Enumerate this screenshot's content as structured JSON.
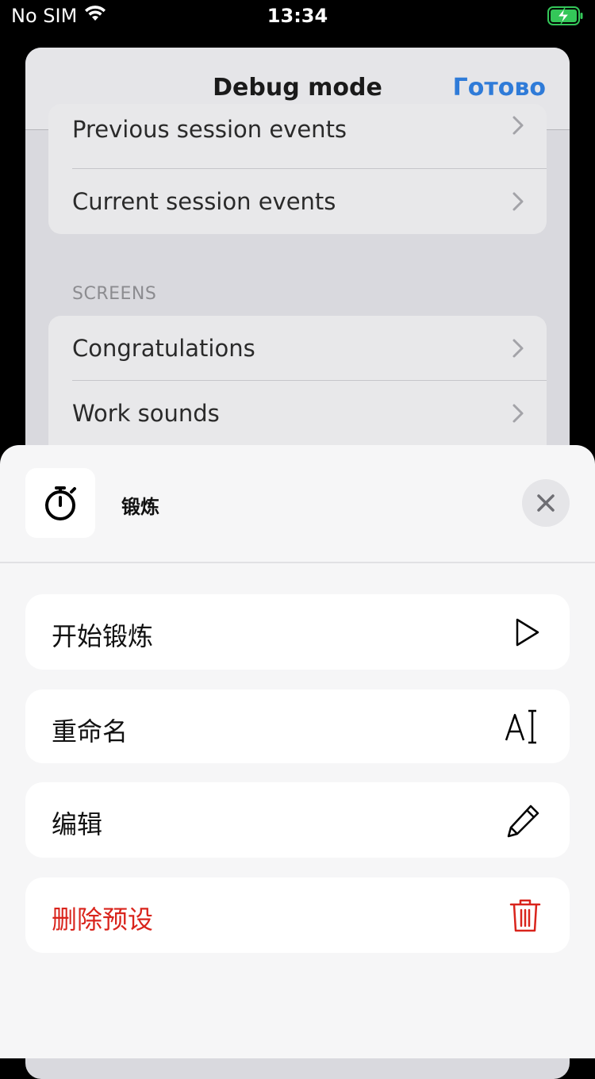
{
  "status_bar": {
    "carrier": "No SIM",
    "time": "13:34",
    "icons": [
      "wifi-icon",
      "battery-charging-icon"
    ],
    "battery_color": "#34c759"
  },
  "background_screen": {
    "title": "Debug mode",
    "done_label": "Готово",
    "events_items": [
      "Previous session events",
      "Current session events"
    ],
    "section_screens": "SCREENS",
    "screens_items": [
      "Congratulations",
      "Work sounds"
    ],
    "accent_color": "#2f7bd8"
  },
  "sheet": {
    "app_icon": "stopwatch-icon",
    "title": "锻炼",
    "close_icon": "close-icon",
    "actions": [
      {
        "label": "开始锻炼",
        "icon": "play-icon"
      },
      {
        "label": "重命名",
        "icon": "rename-text-icon"
      },
      {
        "label": "编辑",
        "icon": "pencil-icon"
      },
      {
        "label": "删除预设",
        "icon": "trash-icon",
        "destructive": true
      }
    ],
    "danger_color": "#d9241c"
  }
}
